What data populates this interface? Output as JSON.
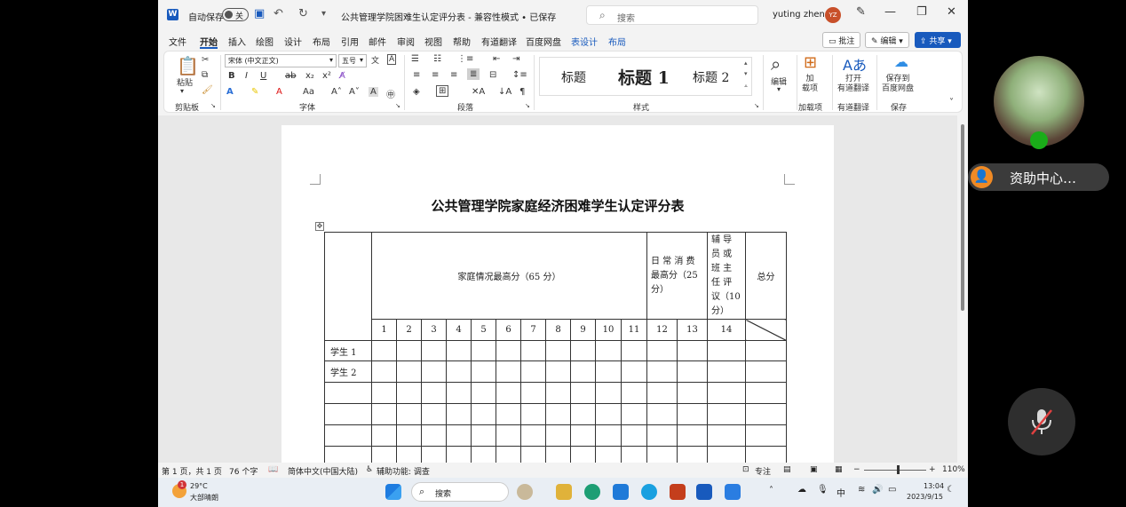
{
  "titlebar": {
    "autosave_label": "自动保存",
    "autosave_state": "关",
    "document_title": "公共管理学院困难生认定评分表 - 兼容性模式 • 已保存",
    "search_placeholder": "搜索",
    "user_name": "yuting zheng",
    "user_initials": "YZ"
  },
  "tabs": [
    "文件",
    "开始",
    "插入",
    "绘图",
    "设计",
    "布局",
    "引用",
    "邮件",
    "审阅",
    "视图",
    "帮助",
    "有道翻译",
    "百度网盘",
    "表设计",
    "布局"
  ],
  "tab_buttons": {
    "comment": "批注",
    "edit": "编辑",
    "share": "共享"
  },
  "ribbon": {
    "clipboard": {
      "paste": "粘贴",
      "label": "剪贴板"
    },
    "font": {
      "name": "宋体 (中文正文)",
      "size": "五号",
      "label": "字体"
    },
    "paragraph": {
      "label": "段落"
    },
    "styles": {
      "items": [
        "标题",
        "标题 1",
        "标题 2"
      ],
      "label": "样式"
    },
    "editing": {
      "label": "编辑"
    },
    "addins": {
      "button": "加\n载项",
      "label": "加载项"
    },
    "youdao": {
      "button": "打开\n有道翻译",
      "label": "有道翻译"
    },
    "baidu": {
      "button": "保存到\n百度网盘",
      "label": "保存"
    }
  },
  "document": {
    "title": "公共管理学院家庭经济困难学生认定评分表",
    "table": {
      "family_header": "家庭情况最高分（65 分）",
      "daily_header": "日 常 消 费 最高分（25 分）",
      "counselor_header": "辅 导 员 或 班 主 任 评 议（10 分）",
      "total_header": "总分",
      "columns": [
        "1",
        "2",
        "3",
        "4",
        "5",
        "6",
        "7",
        "8",
        "9",
        "10",
        "11",
        "12",
        "13",
        "14"
      ],
      "rows": [
        "学生 1",
        "学生 2",
        "",
        "",
        "",
        ""
      ]
    }
  },
  "statusbar": {
    "page": "第 1 页，共 1 页",
    "words": "76 个字",
    "language": "简体中文(中国大陆)",
    "accessibility": "辅助功能: 调查",
    "focus": "专注",
    "zoom": "110%"
  },
  "taskbar": {
    "temperature": "29°C",
    "weather": "大部晴朗",
    "badge": "1",
    "search_placeholder": "搜索",
    "ime": "中",
    "time": "13:04",
    "date": "2023/9/15"
  },
  "meeting": {
    "participant_name": "资助中心…"
  }
}
